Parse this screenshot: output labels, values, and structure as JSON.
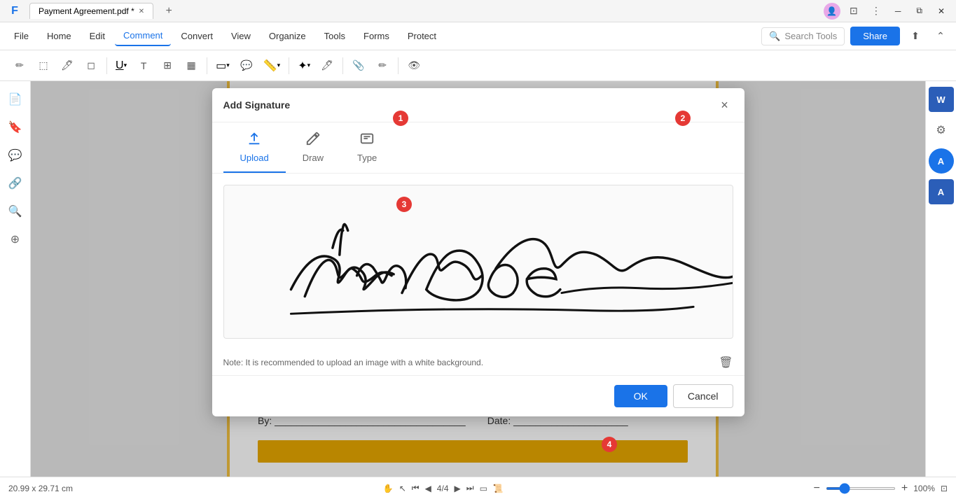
{
  "titlebar": {
    "tab_title": "Payment Agreement.pdf *",
    "add_tab": "+",
    "app_icon": "📄"
  },
  "menubar": {
    "file": "File",
    "items": [
      "Home",
      "Edit",
      "Comment",
      "Convert",
      "View",
      "Organize",
      "Tools",
      "Forms",
      "Protect"
    ],
    "active_item": "Comment",
    "search_placeholder": "Search Tools",
    "share_label": "Share"
  },
  "toolbar": {
    "buttons": [
      "✏️",
      "🔲",
      "✒️",
      "🧹",
      "U",
      "T",
      "⊞",
      "▦",
      "▭",
      "💬",
      "📅",
      "✍️",
      "🖊️",
      "📎",
      "✍",
      "👁"
    ]
  },
  "sidebar": {
    "icons": [
      "📄",
      "🔖",
      "💬",
      "🔗",
      "🔍",
      "⊕"
    ]
  },
  "modal": {
    "title": "Add Signature",
    "close": "×",
    "tabs": [
      {
        "label": "Upload",
        "icon": "upload",
        "active": true
      },
      {
        "label": "Draw",
        "icon": "draw",
        "active": false
      },
      {
        "label": "Type",
        "icon": "type",
        "active": false
      }
    ],
    "note": "Note: It is recommended to upload an image with a white background.",
    "ok_label": "OK",
    "cancel_label": "Cancel"
  },
  "statusbar": {
    "dimensions": "20.99 x 29.71 cm",
    "page_current": "4",
    "page_total": "4",
    "zoom": "100%"
  },
  "pdf_bottom": {
    "by_label": "By: ___________________________________",
    "date_label": "Date: _____________________"
  },
  "steps": {
    "s1": "1",
    "s2": "2",
    "s3": "3",
    "s4": "4"
  },
  "right_sidebar": {
    "icons": [
      "W",
      "A",
      "A"
    ]
  }
}
